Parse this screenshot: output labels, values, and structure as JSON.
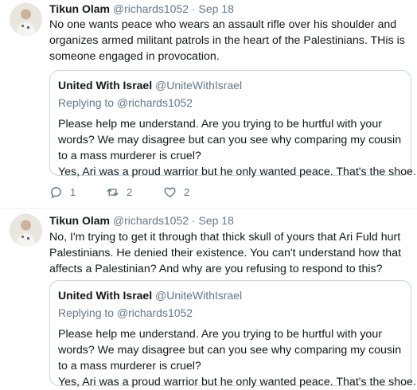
{
  "tweets": [
    {
      "author_name": "Tikun Olam",
      "author_handle": "@richards1052",
      "separator": "·",
      "date": "Sep 18",
      "text": "No one wants peace who wears an assault rifle over his shoulder and organizes armed militant patrols in the heart of the Palestinians.  THis is someone engaged in provocation.",
      "quote": {
        "author_name": "United With Israel",
        "author_handle": "@UniteWithIsrael",
        "replying_label": "Replying to",
        "replying_handle": "@richards1052",
        "text": "Please help me understand. Are you trying to be hurtful with your words? We may disagree but can you see why comparing my cousin to a mass murderer is cruel?",
        "text2": "Yes, Ari was a proud warrior but he only wanted peace. That's the shoe..."
      },
      "actions": {
        "replies": "1",
        "retweets": "2",
        "likes": "2"
      }
    },
    {
      "author_name": "Tikun Olam",
      "author_handle": "@richards1052",
      "separator": "·",
      "date": "Sep 18",
      "text": "No, I'm trying to get it through that thick skull of yours that Ari Fuld hurt Palestinians. He denied their existence. You can't understand how that affects a Palestinian? And why are you refusing to respond to this?",
      "quote": {
        "author_name": "United With Israel",
        "author_handle": "@UniteWithIsrael",
        "replying_label": "Replying to",
        "replying_handle": "@richards1052",
        "text": "Please help me understand. Are you trying to be hurtful with your words? We may disagree but can you see why comparing my cousin to a mass murderer is cruel?",
        "text2": "Yes, Ari was a proud warrior but he only wanted peace. That's the shoe..."
      }
    }
  ],
  "colors": {
    "text": "#14171a",
    "secondary": "#657786",
    "border": "#ccd6dd",
    "divider": "#e6ecf0"
  },
  "icons": [
    "reply-icon",
    "retweet-icon",
    "like-icon",
    "avatar"
  ]
}
